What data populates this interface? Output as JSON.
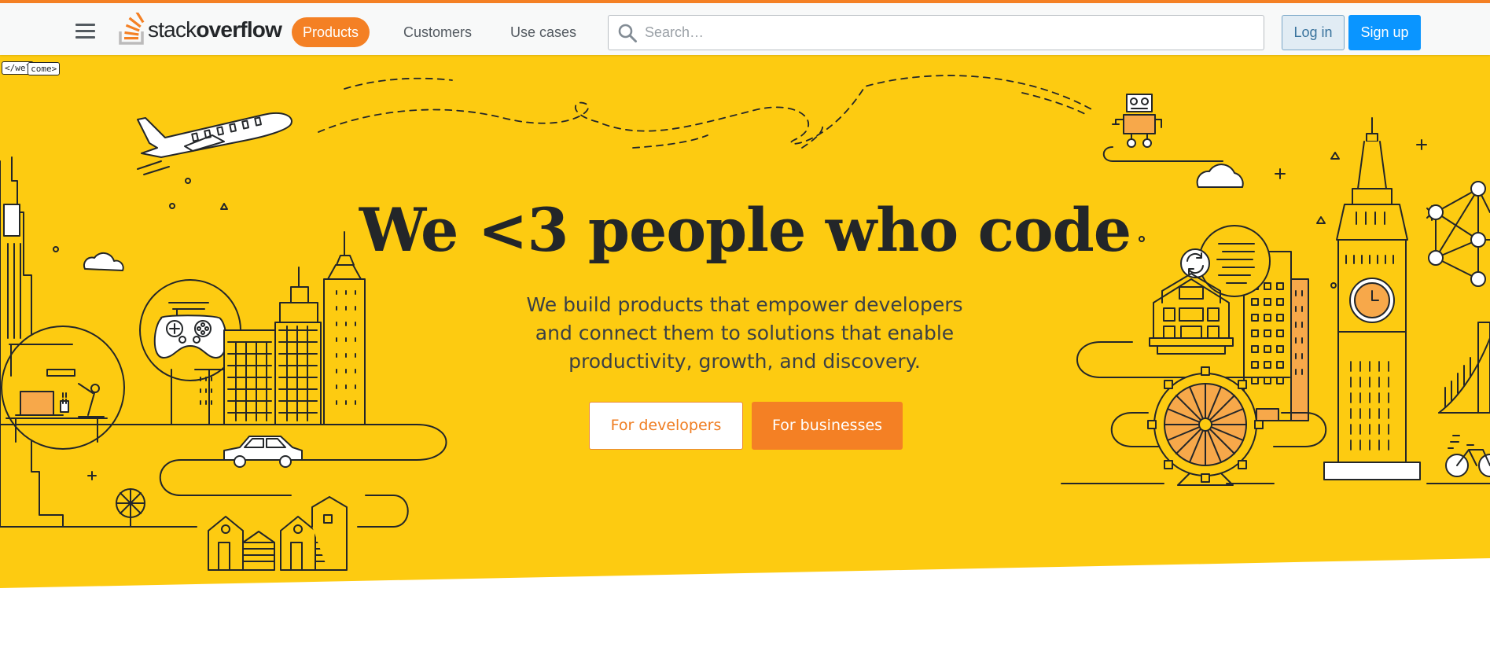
{
  "header": {
    "logo": {
      "text_light": "stack",
      "text_bold": "overflow"
    },
    "nav": [
      {
        "label": "Products",
        "active": true
      },
      {
        "label": "Customers",
        "active": false
      },
      {
        "label": "Use cases",
        "active": false
      }
    ],
    "search": {
      "placeholder": "Search…",
      "value": ""
    },
    "login_label": "Log in",
    "signup_label": "Sign up"
  },
  "hero": {
    "title": "We <3 people who code",
    "subtitle": "We build products that empower developers and connect them to solutions that enable productivity, growth, and discovery.",
    "cta_developers": "For developers",
    "cta_businesses": "For businesses",
    "welcome_tag": {
      "part1": "</wel",
      "part2": "come>"
    }
  },
  "colors": {
    "brand_orange": "#f48024",
    "hero_yellow": "#fdcb11",
    "signup_blue": "#0a95ff",
    "login_bg": "#e1ecf4",
    "text_dark": "#232629"
  },
  "icons": {
    "menu": "hamburger-icon",
    "search": "search-icon",
    "logo": "stack-overflow-logo-icon"
  }
}
